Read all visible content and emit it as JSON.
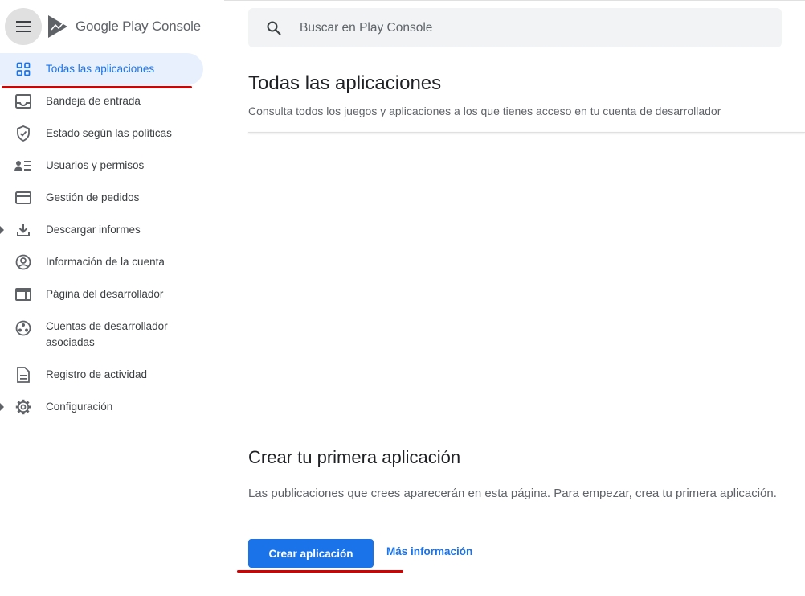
{
  "app": {
    "brand": "Google Play",
    "brand_suffix": "Console"
  },
  "search": {
    "placeholder": "Buscar en Play Console"
  },
  "sidebar": {
    "items": [
      {
        "label": "Todas las aplicaciones",
        "icon": "apps-grid-icon",
        "active": true
      },
      {
        "label": "Bandeja de entrada",
        "icon": "inbox-icon"
      },
      {
        "label": "Estado según las políticas",
        "icon": "shield-check-icon"
      },
      {
        "label": "Usuarios y permisos",
        "icon": "users-list-icon"
      },
      {
        "label": "Gestión de pedidos",
        "icon": "credit-card-icon"
      },
      {
        "label": "Descargar informes",
        "icon": "download-icon",
        "expandable": true
      },
      {
        "label": "Información de la cuenta",
        "icon": "account-circle-icon"
      },
      {
        "label": "Página del desarrollador",
        "icon": "web-page-icon"
      },
      {
        "label": "Cuentas de desarrollador asociadas",
        "icon": "linked-accounts-icon"
      },
      {
        "label": "Registro de actividad",
        "icon": "document-icon"
      },
      {
        "label": "Configuración",
        "icon": "gear-icon",
        "expandable": true
      }
    ]
  },
  "main": {
    "title": "Todas las aplicaciones",
    "subtitle": "Consulta todos los juegos y aplicaciones a los que tienes acceso en tu cuenta de desarrollador",
    "empty_state": {
      "title": "Crear tu primera aplicación",
      "description": "Las publicaciones que crees aparecerán en esta página. Para empezar, crea tu primera aplicación.",
      "primary_button": "Crear aplicación",
      "secondary_link": "Más información"
    }
  },
  "colors": {
    "accent": "#1a73e8",
    "active_bg": "#e8f0fe",
    "annotation_red": "#d50000"
  }
}
